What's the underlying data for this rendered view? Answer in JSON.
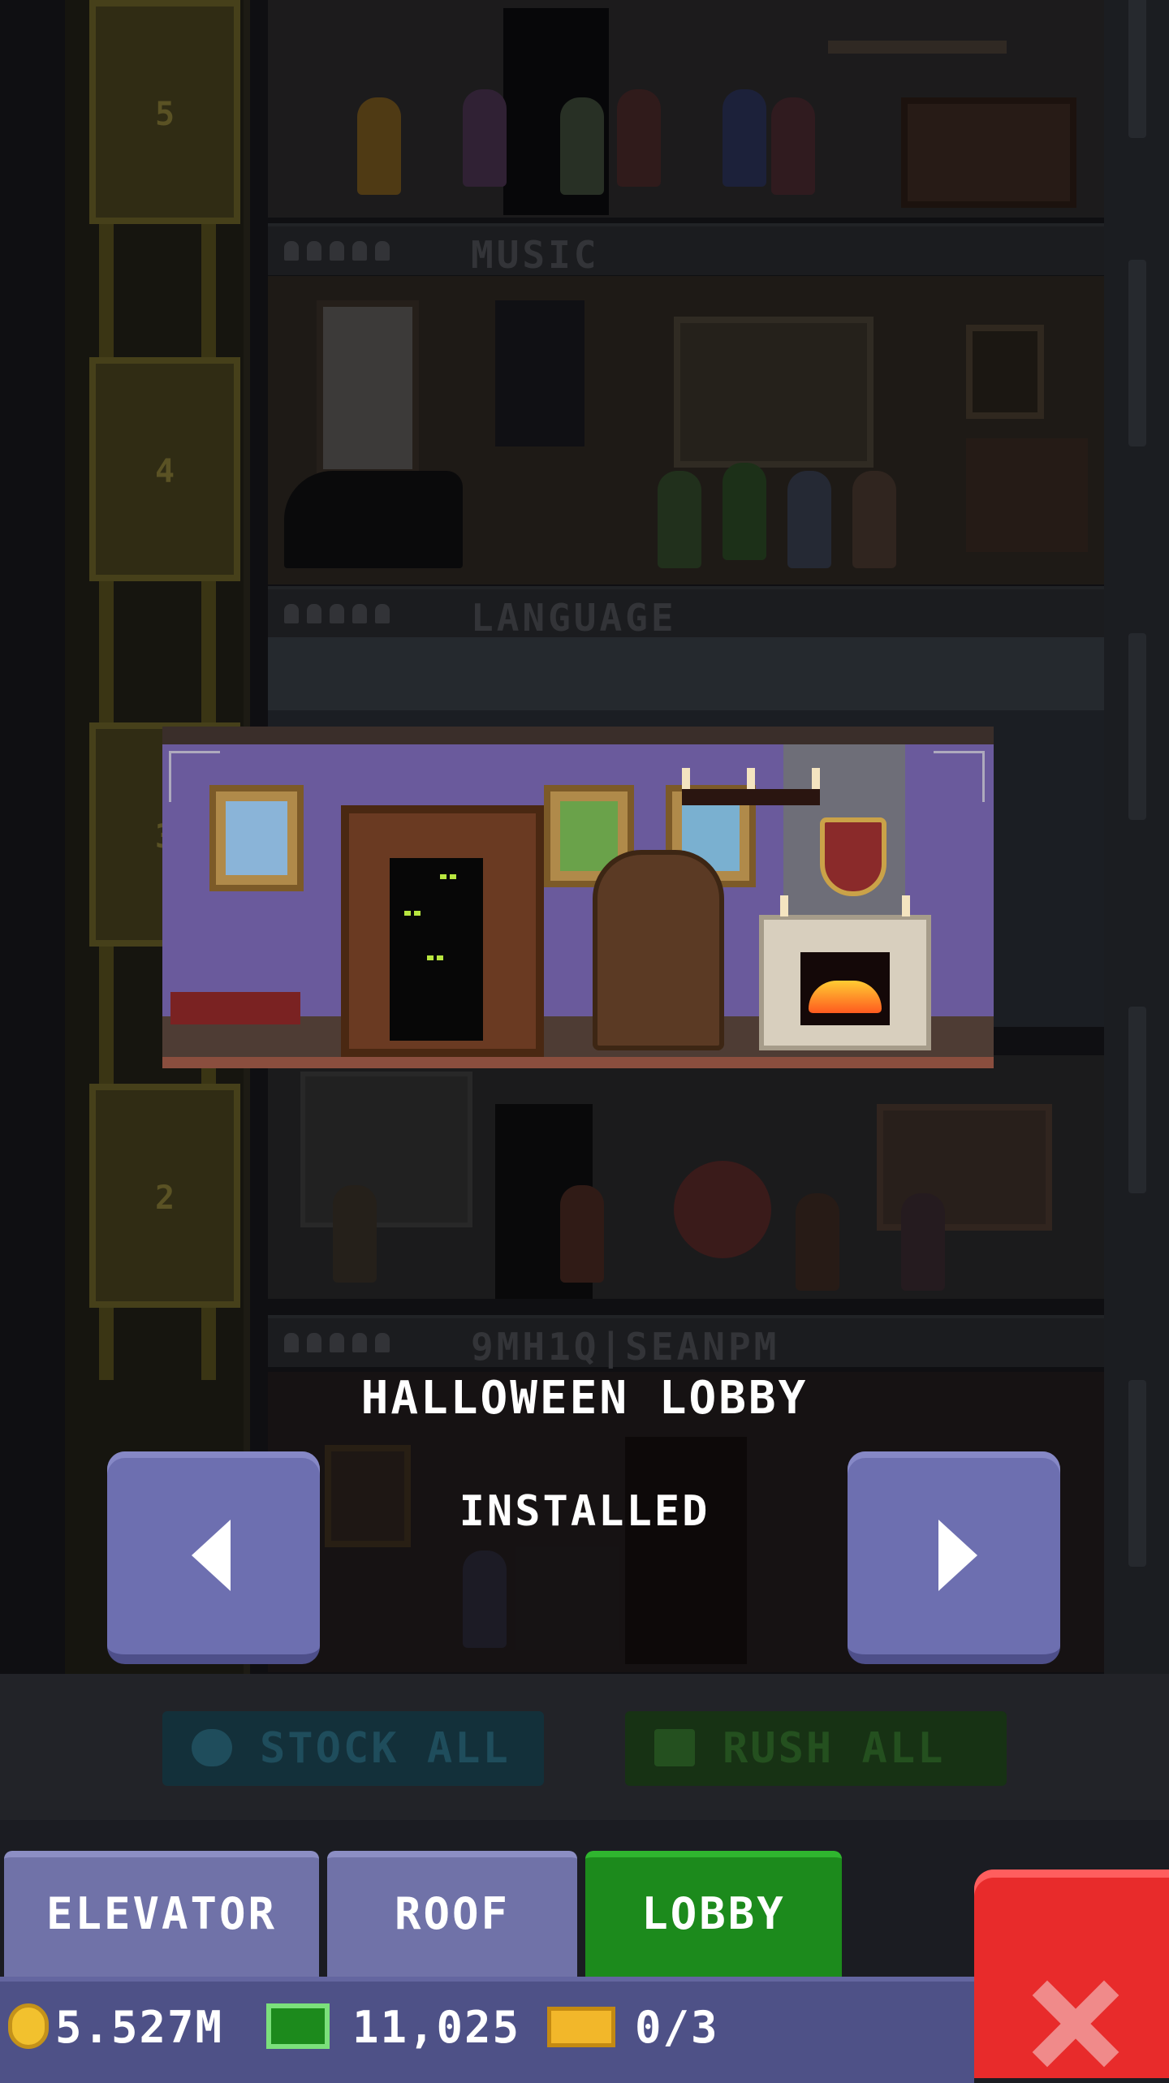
{
  "tower": {
    "floors": [
      {
        "label": "MUSIC"
      },
      {
        "label": "LANGUAGE"
      },
      {
        "label": "9MH1Q|SEANPM"
      }
    ],
    "elevator_numbers": [
      "5",
      "4",
      "3",
      "2"
    ]
  },
  "preview": {
    "skin_name": "HALLOWEEN LOBBY",
    "status": "INSTALLED"
  },
  "dimmed_actions": {
    "stock_all": "STOCK ALL",
    "rush_all": "RUSH ALL"
  },
  "tabs": [
    {
      "label": "ELEVATOR",
      "active": false
    },
    {
      "label": "ROOF",
      "active": false
    },
    {
      "label": "LOBBY",
      "active": true
    }
  ],
  "currency": {
    "coins": "5.527M",
    "bux": "11,025",
    "tickets": "0/3"
  },
  "colors": {
    "tab_active": "#1c8a1c",
    "tab_inactive": "#7072a8",
    "close": "#e82b2b",
    "nav": "#6d6fb0"
  }
}
